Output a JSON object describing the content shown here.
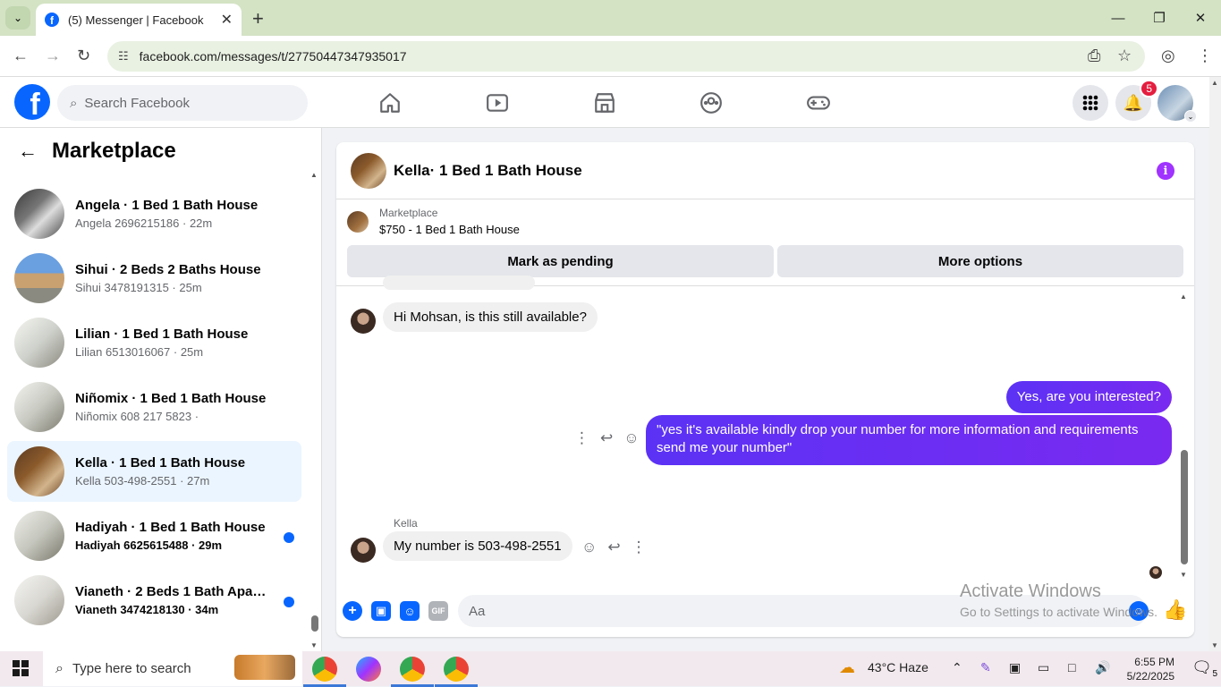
{
  "browser": {
    "tab_title": "(5) Messenger | Facebook",
    "url": "facebook.com/messages/t/27750447347935017",
    "icons": [
      "chevron-down-icon",
      "close-icon",
      "plus-icon",
      "minimize-icon",
      "restore-icon",
      "close-window-icon",
      "back-icon",
      "forward-icon",
      "reload-icon",
      "site-info-icon",
      "install-icon",
      "star-icon",
      "profile-icon",
      "kebab-menu-icon"
    ]
  },
  "fb_header": {
    "search_placeholder": "Search Facebook",
    "notifications_count": "5"
  },
  "sidebar": {
    "title": "Marketplace",
    "conversations": [
      {
        "name": "Angela · 1 Bed 1 Bath House",
        "sub": "Angela 2696215186 · 22m",
        "unread": false,
        "active": false
      },
      {
        "name": "Sihui · 2 Beds 2 Baths House",
        "sub": "Sihui 3478191315 · 25m",
        "unread": false,
        "active": false
      },
      {
        "name": "Lilian · 1 Bed 1 Bath House",
        "sub": "Lilian 6513016067 · 25m",
        "unread": false,
        "active": false
      },
      {
        "name": "Niñomix · 1 Bed 1 Bath House",
        "sub": "Niñomix 608 217 5823 ·",
        "unread": false,
        "active": false
      },
      {
        "name": "Kella · 1 Bed 1 Bath House",
        "sub": "Kella 503-498-2551 · 27m",
        "unread": false,
        "active": true
      },
      {
        "name": "Hadiyah · 1 Bed 1 Bath House",
        "sub": "Hadiyah 6625615488 · 29m",
        "unread": true,
        "active": false
      },
      {
        "name": "Vianeth · 2 Beds 1 Bath Apart...",
        "sub": "Vianeth 3474218130 · 34m",
        "unread": true,
        "active": false
      }
    ]
  },
  "chat": {
    "title": "Kella· 1 Bed 1 Bath House",
    "listing_label": "Marketplace",
    "listing_detail": "$750 - 1 Bed 1 Bath House",
    "mark_pending": "Mark as pending",
    "more_options": "More options",
    "msg1": "Hi Mohsan, is this still available?",
    "msg2": "Yes, are you interested?",
    "msg3": "\"yes it's available kindly drop your number for more information and requirements send me your number\"",
    "sender": "Kella",
    "msg4": "My number is 503-498-2551",
    "input_placeholder": "Aa"
  },
  "watermark": {
    "line1": "Activate Windows",
    "line2": "Go to Settings to activate Windows."
  },
  "taskbar": {
    "search_placeholder": "Type here to search",
    "weather": "43°C  Haze",
    "time": "6:55 PM",
    "date": "5/22/2025",
    "notif_count": "5"
  },
  "colors": {
    "fb_blue": "#0866ff",
    "messenger_purple": "#6c2bf4",
    "unread_dot": "#0866ff",
    "badge_red": "#e41e3f"
  }
}
